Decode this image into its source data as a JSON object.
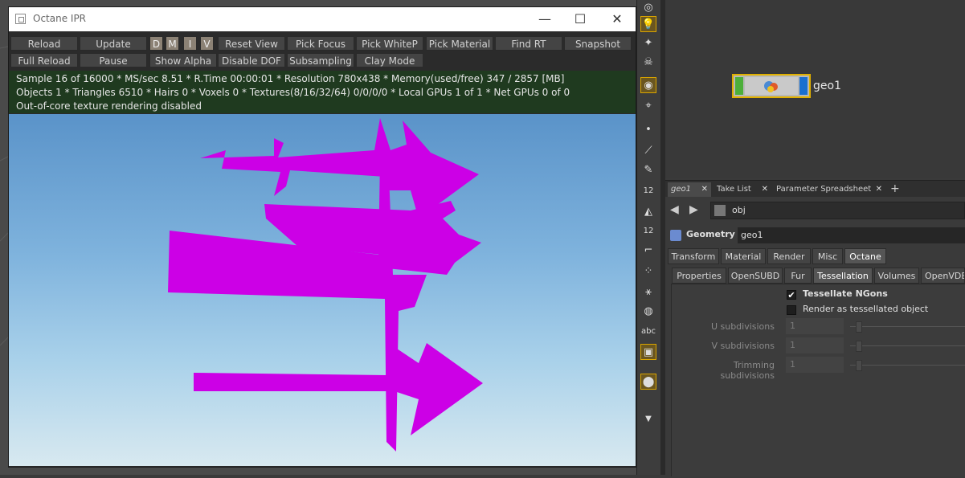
{
  "ipr_window": {
    "title": "Octane IPR",
    "controls": {
      "minimize": "—",
      "maximize": "☐",
      "close": "✕"
    },
    "toolbar_row1": [
      "Reload",
      "Update",
      "D",
      "M",
      "I",
      "V",
      "Reset View",
      "Pick Focus",
      "Pick WhiteP",
      "Pick Material",
      "Find RT",
      "Snapshot"
    ],
    "toolbar_row2": [
      "Full Reload",
      "Pause",
      "Show Alpha",
      "Disable DOF",
      "Subsampling",
      "Clay Mode"
    ],
    "status_lines": [
      "Sample 16 of 16000 * MS/sec 8.51 * R.Time 00:00:01 * Resolution 780x438 * Memory(used/free) 347 / 2857 [MB]",
      "Objects 1 * Triangles 6510 * Hairs 0 * Voxels 0 * Textures(8/16/32/64) 0/0/0/0 * Local GPUs 1 of 1 * Net GPUs 0 of 0",
      "Out-of-core texture rendering disabled"
    ],
    "render": {
      "shape_color": "#cc00e6",
      "sky_top": "#5a93c9",
      "sky_bottom": "#d8e9f0"
    }
  },
  "shelf": {
    "icons": [
      "sun-icon",
      "lightbulb-icon",
      "light-icon",
      "skull-icon",
      "camera-icon",
      "camera-outline-icon",
      "point-icon",
      "line-icon",
      "pen-icon",
      "number-12-icon",
      "bucket-icon",
      "number-12b-icon",
      "curve-icon",
      "nodes-icon",
      "branch-icon",
      "circle-icon",
      "abc-icon",
      "image-icon",
      "pin-icon"
    ],
    "text_abc": "abc",
    "text_12": "12"
  },
  "network": {
    "node_label": "geo1"
  },
  "params": {
    "pane_tabs": [
      "geo1",
      "Take List",
      "Parameter Spreadsheet"
    ],
    "add_tab": "+",
    "path": "obj",
    "node_type": "Geometry",
    "node_name": "geo1",
    "main_tabs": [
      "Transform",
      "Material",
      "Render",
      "Misc",
      "Octane"
    ],
    "sub_tabs": [
      "Properties",
      "OpenSUBD",
      "Fur",
      "Tessellation",
      "Volumes",
      "OpenVDB"
    ],
    "tessellate_ngons": {
      "label": "Tessellate NGons",
      "checked": true
    },
    "render_tessellated": {
      "label": "Render as tessellated object",
      "checked": false
    },
    "u_subdivisions": {
      "label": "U subdivisions",
      "value": "1"
    },
    "v_subdivisions": {
      "label": "V subdivisions",
      "value": "1"
    },
    "trimming_subdivisions": {
      "label": "Trimming subdivisions",
      "value": "1"
    }
  }
}
